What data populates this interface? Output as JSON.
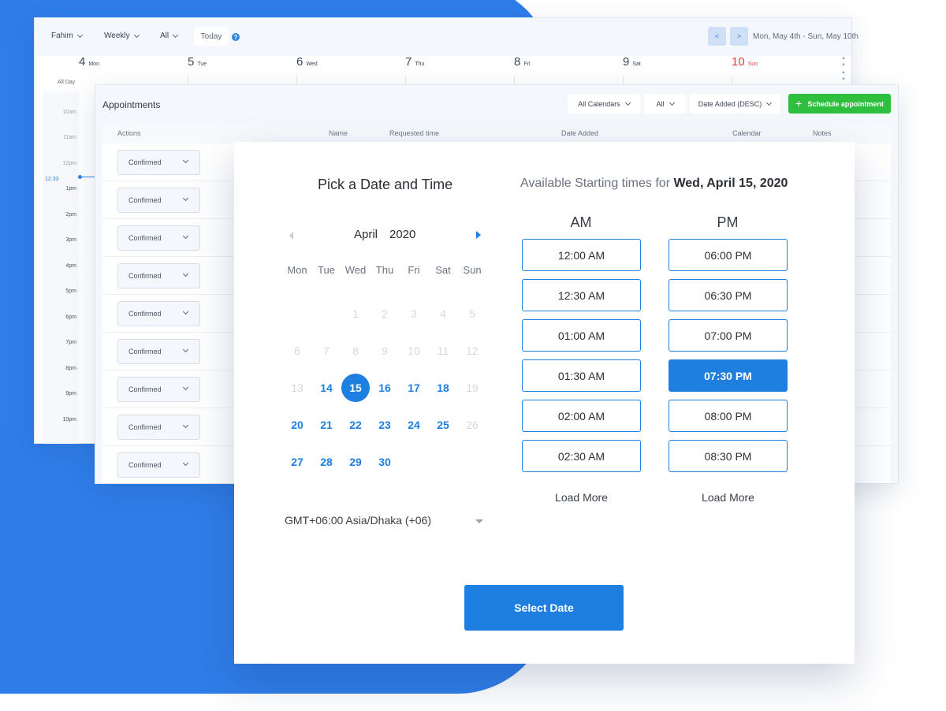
{
  "calendar": {
    "toolbar": {
      "user": "Fahim",
      "view": "Weekly",
      "filter": "All",
      "today": "Today",
      "prev": "<",
      "next": ">",
      "range": "Mon, May 4th - Sun, May 10th"
    },
    "days": [
      {
        "num": "4",
        "name": "Mon"
      },
      {
        "num": "5",
        "name": "Tue"
      },
      {
        "num": "6",
        "name": "Wed"
      },
      {
        "num": "7",
        "name": "Thu"
      },
      {
        "num": "8",
        "name": "Fri"
      },
      {
        "num": "9",
        "name": "Sat"
      },
      {
        "num": "10",
        "name": "Sun"
      }
    ],
    "all_day": "All Day",
    "times": [
      "10am",
      "11am",
      "12pm",
      "1pm",
      "2pm",
      "3pm",
      "4pm",
      "5pm",
      "6pm",
      "7pm",
      "8pm",
      "9pm",
      "10pm"
    ],
    "now": "12:33"
  },
  "appointments": {
    "title": "Appointments",
    "filters": {
      "calendars": "All Calendars",
      "status": "All",
      "sort": "Date Added (DESC)"
    },
    "schedule_button": "Schedule appointment",
    "columns": [
      "Actions",
      "Name",
      "Requested time",
      "Date Added",
      "Calendar",
      "Notes"
    ],
    "rows": [
      "Confirmed",
      "Confirmed",
      "Confirmed",
      "Confirmed",
      "Confirmed",
      "Confirmed",
      "Confirmed",
      "Confirmed",
      "Confirmed"
    ]
  },
  "picker": {
    "title": "Pick a Date and Time",
    "available_prefix": "Available Starting times for",
    "available_date": "Wed, April 15, 2020",
    "month": "April",
    "year": "2020",
    "weekdays": [
      "Mon",
      "Tue",
      "Wed",
      "Thu",
      "Fri",
      "Sat",
      "Sun"
    ],
    "weeks": [
      [
        null,
        null,
        {
          "d": "1",
          "s": "disabled"
        },
        {
          "d": "2",
          "s": "disabled"
        },
        {
          "d": "3",
          "s": "disabled"
        },
        {
          "d": "4",
          "s": "disabled"
        },
        {
          "d": "5",
          "s": "disabled"
        }
      ],
      [
        {
          "d": "6",
          "s": "disabled"
        },
        {
          "d": "7",
          "s": "disabled"
        },
        {
          "d": "8",
          "s": "disabled"
        },
        {
          "d": "9",
          "s": "disabled"
        },
        {
          "d": "10",
          "s": "disabled"
        },
        {
          "d": "11",
          "s": "disabled"
        },
        {
          "d": "12",
          "s": "disabled"
        }
      ],
      [
        {
          "d": "13",
          "s": "disabled"
        },
        {
          "d": "14",
          "s": "available"
        },
        {
          "d": "15",
          "s": "selected"
        },
        {
          "d": "16",
          "s": "available"
        },
        {
          "d": "17",
          "s": "available"
        },
        {
          "d": "18",
          "s": "available"
        },
        {
          "d": "19",
          "s": "disabled"
        }
      ],
      [
        {
          "d": "20",
          "s": "available"
        },
        {
          "d": "21",
          "s": "available"
        },
        {
          "d": "22",
          "s": "available"
        },
        {
          "d": "23",
          "s": "available"
        },
        {
          "d": "24",
          "s": "available"
        },
        {
          "d": "25",
          "s": "available"
        },
        {
          "d": "26",
          "s": "disabled"
        }
      ],
      [
        {
          "d": "27",
          "s": "available"
        },
        {
          "d": "28",
          "s": "available"
        },
        {
          "d": "29",
          "s": "available"
        },
        {
          "d": "30",
          "s": "available"
        },
        null,
        null,
        null
      ]
    ],
    "timezone": "GMT+06:00 Asia/Dhaka (+06)",
    "am_label": "AM",
    "pm_label": "PM",
    "am_slots": [
      "12:00 AM",
      "12:30 AM",
      "01:00 AM",
      "01:30 AM",
      "02:00 AM",
      "02:30 AM"
    ],
    "pm_slots": [
      "06:00 PM",
      "06:30 PM",
      "07:00 PM",
      "07:30 PM",
      "08:00 PM",
      "08:30 PM"
    ],
    "selected_slot": "07:30 PM",
    "load_more": "Load More",
    "select_button": "Select Date"
  },
  "colors": {
    "accent": "#1e7fe0",
    "backdrop": "#2f7de8",
    "schedule_green": "#2fbf3f",
    "sunday_red": "#e53b3b"
  }
}
